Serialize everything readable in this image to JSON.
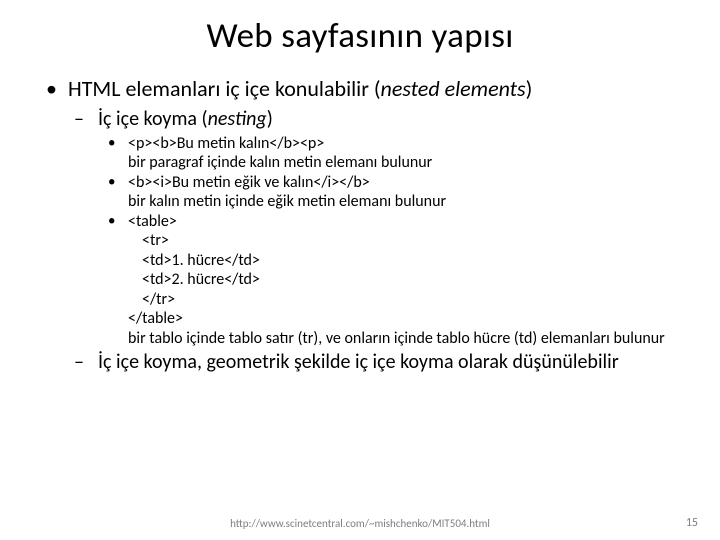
{
  "title": "Web sayfasının yapısı",
  "bullet_main_pre": "HTML elemanları iç içe konulabilir (",
  "bullet_main_it": "nested elements",
  "bullet_main_post": ")",
  "sub1_pre": "İç içe koyma (",
  "sub1_it": "nesting",
  "sub1_post": ")",
  "ex1_code": "<p><b>Bu metin kalın</b><p>",
  "ex1_desc": "bir paragraf içinde kalın metin elemanı bulunur",
  "ex2_code": "<b><i>Bu metin eğik ve kalın</i></b>",
  "ex2_desc": "bir kalın metin içinde eğik metin elemanı bulunur",
  "ex3_l1": "<table>",
  "ex3_l2": "<tr>",
  "ex3_l3": "<td>1. hücre</td>",
  "ex3_l4": "<td>2. hücre</td>",
  "ex3_l5": "</tr>",
  "ex3_l6": "</table>",
  "ex3_desc": "bir tablo içinde tablo satır (tr), ve onların içinde tablo hücre (td) elemanları bulunur",
  "sub2": "İç içe koyma, geometrik şekilde iç içe koyma olarak düşünülebilir",
  "footer": "http://www.scinetcentral.com/~mishchenko/MIT504.html",
  "page": "15"
}
